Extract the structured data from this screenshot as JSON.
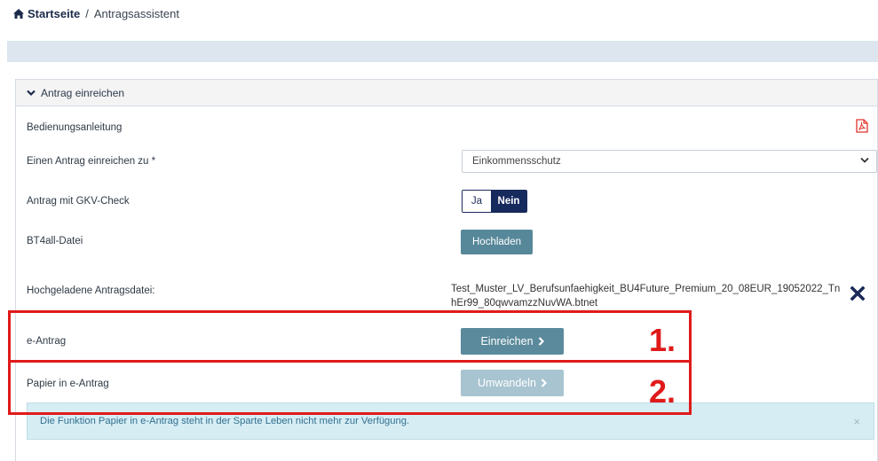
{
  "breadcrumb": {
    "home": "Startseite",
    "separator": "/",
    "current": "Antragsassistent"
  },
  "panel": {
    "header": "Antrag einreichen",
    "rows": {
      "manual": "Bedienungsanleitung",
      "submit_for": "Einen Antrag einreichen zu *",
      "gkv": "Antrag mit GKV-Check",
      "bt4all": "BT4all-Datei",
      "uploaded": "Hochgeladene Antragsdatei:",
      "eantrag": "e-Antrag",
      "paper": "Papier in e-Antrag"
    },
    "select_value": "Einkommensschutz",
    "toggle": {
      "ja": "Ja",
      "nein": "Nein",
      "selected": "Nein"
    },
    "upload_button": "Hochladen",
    "filename": "Test_Muster_LV_Berufsunfaehigkeit_BU4Future_Premium_20_08EUR_19052022_TnhEr99_80qwvamzzNuvWA.btnet",
    "submit_button": "Einreichen",
    "convert_button": "Umwandeln",
    "alert": "Die Funktion Papier in e-Antrag steht in der Sparte Leben nicht mehr zur Verfügung.",
    "alert_close": "×"
  },
  "annotations": {
    "marker1": "1.",
    "marker2": "2."
  },
  "colors": {
    "accent": "#5b8a9c",
    "navy": "#162a5e",
    "highlight": "#e01a1a",
    "alert_bg": "#d7edf4"
  }
}
